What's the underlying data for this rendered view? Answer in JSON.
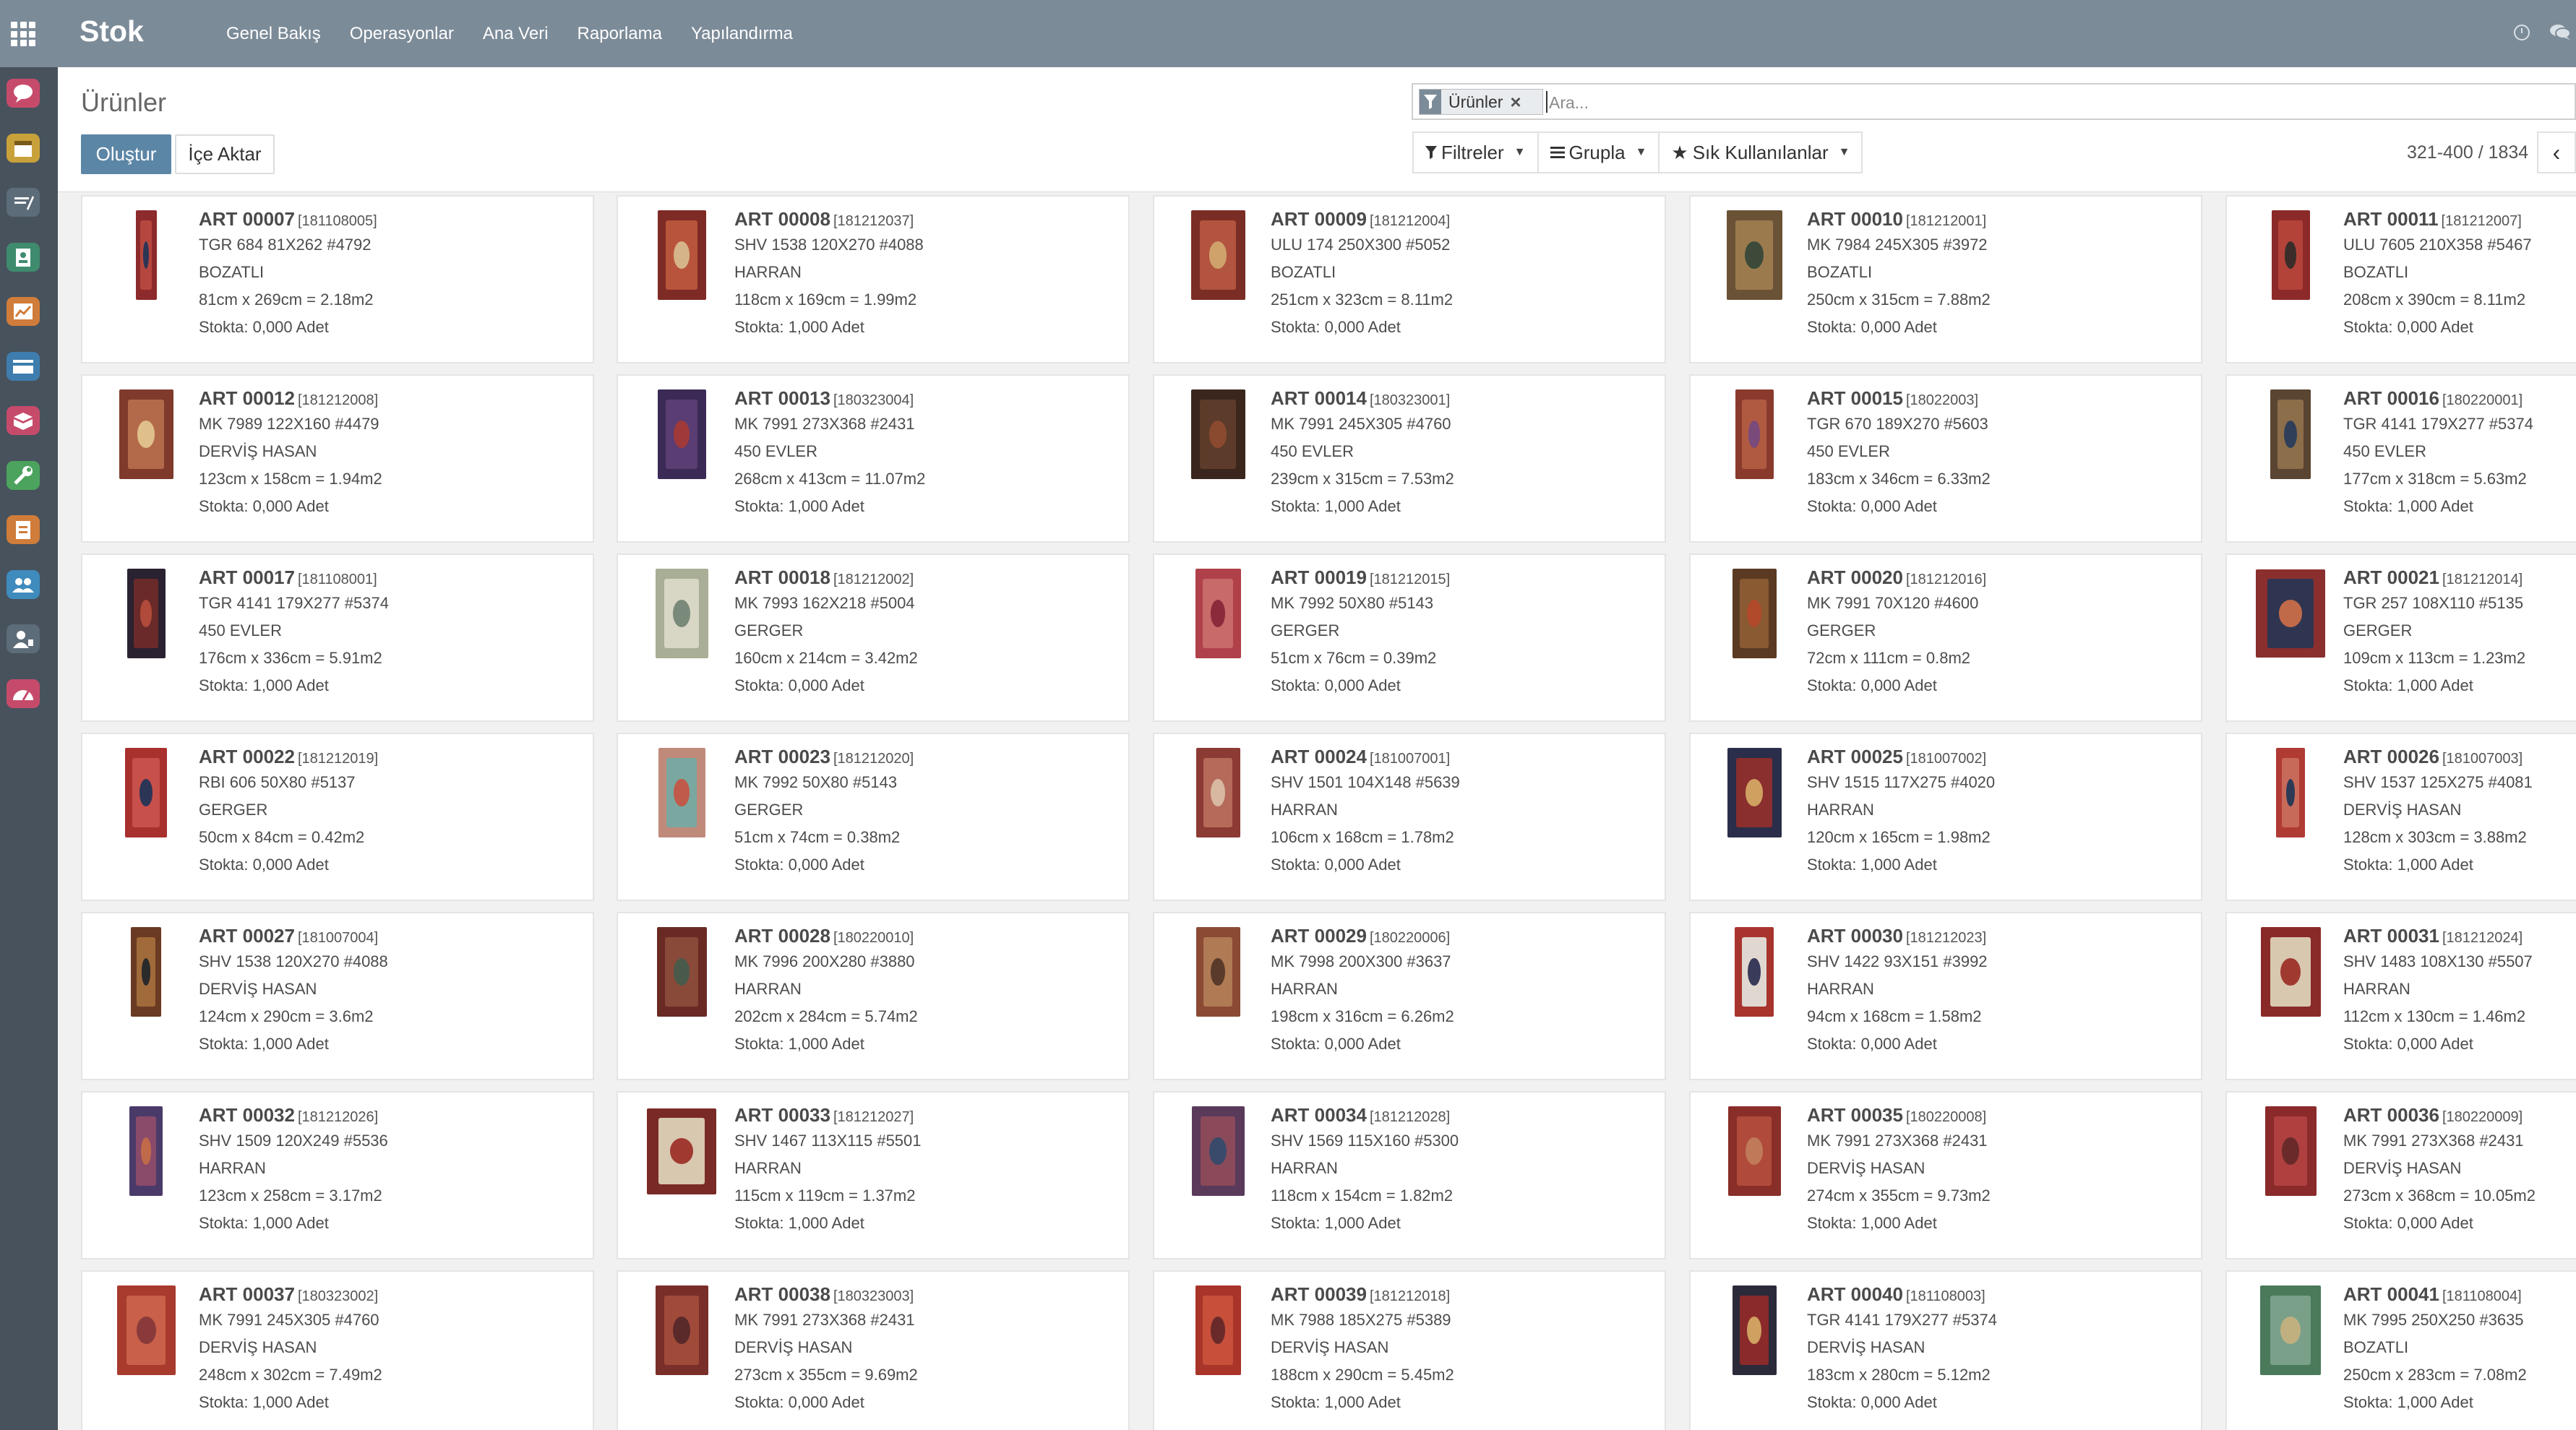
{
  "app": {
    "title": "Stok",
    "menu": [
      "Genel Bakış",
      "Operasyonlar",
      "Ana Veri",
      "Raporlama",
      "Yapılandırma"
    ]
  },
  "sidebar": {
    "items": [
      {
        "icon": "discuss-icon",
        "color": "#c64b6b"
      },
      {
        "icon": "calendar-icon",
        "color": "#c9a13b"
      },
      {
        "icon": "notes-icon",
        "color": "#5d6c79"
      },
      {
        "icon": "contacts-icon",
        "color": "#3f8b6e"
      },
      {
        "icon": "dashboard-icon",
        "color": "#d07c3a"
      },
      {
        "icon": "invoicing-icon",
        "color": "#3f7dae"
      },
      {
        "icon": "inventory-icon",
        "color": "#c64b6b"
      },
      {
        "icon": "settings-icon",
        "color": "#4ca35d"
      },
      {
        "icon": "documents-icon",
        "color": "#d07c3a"
      },
      {
        "icon": "team-icon",
        "color": "#3f8bbd"
      },
      {
        "icon": "employees-icon",
        "color": "#5d6c79"
      },
      {
        "icon": "meter-icon",
        "color": "#c64b6b"
      }
    ]
  },
  "control_panel": {
    "breadcrumb": "Ürünler",
    "create_label": "Oluştur",
    "import_label": "İçe Aktar",
    "search": {
      "facet_label": "Ürünler",
      "facet_remove": "×",
      "placeholder": "Ara..."
    },
    "filters_label": "Filtreler",
    "group_label": "Grupla",
    "favorites_label": "Sık Kullanılanlar",
    "pager": "321-400 / 1834",
    "pager_prev": "‹"
  },
  "products": [
    {
      "name": "ART 00007",
      "code": "[181108005]",
      "model": "TGR 684 81X262 #4792",
      "supplier": "BOZATLI",
      "size": "81cm x 269cm = 2.18m2",
      "stock": "Stokta: 0,000 Adet",
      "rug": {
        "w": 0.3,
        "h": 1.0,
        "base": "#8c2a2c",
        "field": "#b5473e",
        "medal": "#2d3556"
      }
    },
    {
      "name": "ART 00008",
      "code": "[181212037]",
      "model": "SHV 1538 120X270 #4088",
      "supplier": "HARRAN",
      "size": "118cm x 169cm = 1.99m2",
      "stock": "Stokta: 1,000 Adet",
      "rug": {
        "w": 0.7,
        "h": 1.0,
        "base": "#7e2a25",
        "field": "#b8543b",
        "medal": "#d6b48a"
      }
    },
    {
      "name": "ART 00009",
      "code": "[181212004]",
      "model": "ULU 174 250X300 #5052",
      "supplier": "BOZATLI",
      "size": "251cm x 323cm = 8.11m2",
      "stock": "Stokta: 0,000 Adet",
      "rug": {
        "w": 0.78,
        "h": 1.0,
        "base": "#7a2d24",
        "field": "#b2543f",
        "medal": "#cfa26c"
      }
    },
    {
      "name": "ART 00010",
      "code": "[181212001]",
      "model": "MK 7984 245X305 #3972",
      "supplier": "BOZATLI",
      "size": "250cm x 315cm = 7.88m2",
      "stock": "Stokta: 0,000 Adet",
      "rug": {
        "w": 0.8,
        "h": 1.0,
        "base": "#6a5236",
        "field": "#9b7b4e",
        "medal": "#3d4a3a"
      }
    },
    {
      "name": "ART 00011",
      "code": "[181212007]",
      "model": "ULU 7605 210X358 #5467",
      "supplier": "BOZATLI",
      "size": "208cm x 390cm = 8.11m2",
      "stock": "Stokta: 0,000 Adet",
      "rug": {
        "w": 0.55,
        "h": 1.0,
        "base": "#8c2a2a",
        "field": "#b34339",
        "medal": "#3a2d2a"
      }
    },
    {
      "name": "ART 00012",
      "code": "[181212008]",
      "model": "MK 7989 122X160 #4479",
      "supplier": "DERVİŞ HASAN",
      "size": "123cm x 158cm = 1.94m2",
      "stock": "Stokta: 0,000 Adet",
      "rug": {
        "w": 0.78,
        "h": 1.0,
        "base": "#7f3a2b",
        "field": "#b36a4a",
        "medal": "#e0c08a"
      }
    },
    {
      "name": "ART 00013",
      "code": "[180323004]",
      "model": "MK 7991 273X368 #2431",
      "supplier": "450 EVLER",
      "size": "268cm x 413cm = 11.07m2",
      "stock": "Stokta: 1,000 Adet",
      "rug": {
        "w": 0.7,
        "h": 1.0,
        "base": "#3b2a55",
        "field": "#5a3d72",
        "medal": "#a03a3a"
      }
    },
    {
      "name": "ART 00014",
      "code": "[180323001]",
      "model": "MK 7991 245X305 #4760",
      "supplier": "450 EVLER",
      "size": "239cm x 315cm = 7.53m2",
      "stock": "Stokta: 1,000 Adet",
      "rug": {
        "w": 0.78,
        "h": 1.0,
        "base": "#3a261d",
        "field": "#5c3b2a",
        "medal": "#8a4a2f"
      }
    },
    {
      "name": "ART 00015",
      "code": "[18022003]",
      "model": "TGR 670 189X270 #5603",
      "supplier": "450 EVLER",
      "size": "183cm x 346cm = 6.33m2",
      "stock": "Stokta: 0,000 Adet",
      "rug": {
        "w": 0.55,
        "h": 1.0,
        "base": "#8a3a2d",
        "field": "#b05a42",
        "medal": "#7a4a7a"
      }
    },
    {
      "name": "ART 00016",
      "code": "[180220001]",
      "model": "TGR 4141 179X277 #5374",
      "supplier": "450 EVLER",
      "size": "177cm x 318cm = 5.63m2",
      "stock": "Stokta: 1,000 Adet",
      "rug": {
        "w": 0.58,
        "h": 1.0,
        "base": "#5a4432",
        "field": "#8c6e4a",
        "medal": "#2f3f5a"
      }
    },
    {
      "name": "ART 00017",
      "code": "[181108001]",
      "model": "TGR 4141 179X277 #5374",
      "supplier": "450 EVLER",
      "size": "176cm x 336cm = 5.91m2",
      "stock": "Stokta: 1,000 Adet",
      "rug": {
        "w": 0.55,
        "h": 1.0,
        "base": "#2a2230",
        "field": "#6a2a2a",
        "medal": "#b04a3a"
      }
    },
    {
      "name": "ART 00018",
      "code": "[181212002]",
      "model": "MK 7993 162X218 #5004",
      "supplier": "GERGER",
      "size": "160cm x 214cm = 3.42m2",
      "stock": "Stokta: 0,000 Adet",
      "rug": {
        "w": 0.76,
        "h": 1.0,
        "base": "#a9ae96",
        "field": "#d8d6c4",
        "medal": "#7a8a7a"
      }
    },
    {
      "name": "ART 00019",
      "code": "[181212015]",
      "model": "MK 7992 50X80 #5143",
      "supplier": "GERGER",
      "size": "51cm x 76cm = 0.39m2",
      "stock": "Stokta: 0,000 Adet",
      "rug": {
        "w": 0.66,
        "h": 1.0,
        "base": "#b0404a",
        "field": "#c96a6a",
        "medal": "#8a2a3a"
      }
    },
    {
      "name": "ART 00020",
      "code": "[181212016]",
      "model": "MK 7991 70X120 #4600",
      "supplier": "GERGER",
      "size": "72cm x 111cm = 0.8m2",
      "stock": "Stokta: 0,000 Adet",
      "rug": {
        "w": 0.64,
        "h": 1.0,
        "base": "#5a3a22",
        "field": "#8a5a32",
        "medal": "#b04a2a"
      }
    },
    {
      "name": "ART 00021",
      "code": "[181212014]",
      "model": "TGR 257 108X110 #5135",
      "supplier": "GERGER",
      "size": "109cm x 113cm = 1.23m2",
      "stock": "Stokta: 1,000 Adet",
      "rug": {
        "w": 1.0,
        "h": 0.98,
        "base": "#8a2e2e",
        "field": "#2f3550",
        "medal": "#c06a4a"
      }
    },
    {
      "name": "ART 00022",
      "code": "[181212019]",
      "model": "RBI 606 50X80 #5137",
      "supplier": "GERGER",
      "size": "50cm x 84cm = 0.42m2",
      "stock": "Stokta: 0,000 Adet",
      "rug": {
        "w": 0.6,
        "h": 1.0,
        "base": "#a8302d",
        "field": "#c8504a",
        "medal": "#2d3556"
      }
    },
    {
      "name": "ART 00023",
      "code": "[181212020]",
      "model": "MK 7992 50X80 #5143",
      "supplier": "GERGER",
      "size": "51cm x 74cm = 0.38m2",
      "stock": "Stokta: 0,000 Adet",
      "rug": {
        "w": 0.68,
        "h": 1.0,
        "base": "#c08a7a",
        "field": "#7aa8a0",
        "medal": "#c05a4a"
      }
    },
    {
      "name": "ART 00024",
      "code": "[181007001]",
      "model": "SHV 1501 104X148 #5639",
      "supplier": "HARRAN",
      "size": "106cm x 168cm = 1.78m2",
      "stock": "Stokta: 0,000 Adet",
      "rug": {
        "w": 0.64,
        "h": 1.0,
        "base": "#8c3a34",
        "field": "#b56a5a",
        "medal": "#d8b8a0"
      }
    },
    {
      "name": "ART 00025",
      "code": "[181007002]",
      "model": "SHV 1515 117X275 #4020",
      "supplier": "HARRAN",
      "size": "120cm x 165cm = 1.98m2",
      "stock": "Stokta: 1,000 Adet",
      "rug": {
        "w": 0.78,
        "h": 1.0,
        "base": "#2a2e4a",
        "field": "#8a2e2e",
        "medal": "#d0a060"
      }
    },
    {
      "name": "ART 00026",
      "code": "[181007003]",
      "model": "SHV 1537 125X275 #4081",
      "supplier": "DERVİŞ HASAN",
      "size": "128cm x 303cm = 3.88m2",
      "stock": "Stokta: 1,000 Adet",
      "rug": {
        "w": 0.42,
        "h": 1.0,
        "base": "#b03a34",
        "field": "#c86a5a",
        "medal": "#2d3a56"
      }
    },
    {
      "name": "ART 00027",
      "code": "[181007004]",
      "model": "SHV 1538 120X270 #4088",
      "supplier": "DERVİŞ HASAN",
      "size": "124cm x 290cm = 3.6m2",
      "stock": "Stokta: 1,000 Adet",
      "rug": {
        "w": 0.44,
        "h": 1.0,
        "base": "#6a3a22",
        "field": "#a06a3a",
        "medal": "#2a2a2a"
      }
    },
    {
      "name": "ART 00028",
      "code": "[180220010]",
      "model": "MK 7996 200X280 #3880",
      "supplier": "HARRAN",
      "size": "202cm x 284cm = 5.74m2",
      "stock": "Stokta: 1,000 Adet",
      "rug": {
        "w": 0.72,
        "h": 1.0,
        "base": "#6a2a24",
        "field": "#8a4a3a",
        "medal": "#4a5a4a"
      }
    },
    {
      "name": "ART 00029",
      "code": "[180220006]",
      "model": "MK 7998 200X300 #3637",
      "supplier": "HARRAN",
      "size": "198cm x 316cm = 6.26m2",
      "stock": "Stokta: 0,000 Adet",
      "rug": {
        "w": 0.64,
        "h": 1.0,
        "base": "#8a4a34",
        "field": "#b07a54",
        "medal": "#5a3a2a"
      }
    },
    {
      "name": "ART 00030",
      "code": "[181212023]",
      "model": "SHV 1422 93X151 #3992",
      "supplier": "HARRAN",
      "size": "94cm x 168cm = 1.58m2",
      "stock": "Stokta: 0,000 Adet",
      "rug": {
        "w": 0.56,
        "h": 1.0,
        "base": "#a8342e",
        "field": "#e0d8d0",
        "medal": "#3a3a5a"
      }
    },
    {
      "name": "ART 00031",
      "code": "[181212024]",
      "model": "SHV 1483 108X130 #5507",
      "supplier": "HARRAN",
      "size": "112cm x 130cm = 1.46m2",
      "stock": "Stokta: 0,000 Adet",
      "rug": {
        "w": 0.86,
        "h": 1.0,
        "base": "#8a2a28",
        "field": "#d8c8b0",
        "medal": "#a03a30"
      }
    },
    {
      "name": "ART 00032",
      "code": "[181212026]",
      "model": "SHV 1509 120X249 #5536",
      "supplier": "HARRAN",
      "size": "123cm x 258cm = 3.17m2",
      "stock": "Stokta: 1,000 Adet",
      "rug": {
        "w": 0.48,
        "h": 1.0,
        "base": "#4a3a6a",
        "field": "#8a4a6a",
        "medal": "#c06a4a"
      }
    },
    {
      "name": "ART 00033",
      "code": "[181212027]",
      "model": "SHV 1467 113X115 #5501",
      "supplier": "HARRAN",
      "size": "115cm x 119cm = 1.37m2",
      "stock": "Stokta: 1,000 Adet",
      "rug": {
        "w": 1.0,
        "h": 0.96,
        "base": "#7a2a26",
        "field": "#d8c8b0",
        "medal": "#a03a30"
      }
    },
    {
      "name": "ART 00034",
      "code": "[181212028]",
      "model": "SHV 1569 115X160 #5300",
      "supplier": "HARRAN",
      "size": "118cm x 154cm = 1.82m2",
      "stock": "Stokta: 1,000 Adet",
      "rug": {
        "w": 0.76,
        "h": 1.0,
        "base": "#5a3a5a",
        "field": "#8a4a5a",
        "medal": "#3a4a6a"
      }
    },
    {
      "name": "ART 00035",
      "code": "[180220008]",
      "model": "MK 7991 273X368 #2431",
      "supplier": "DERVİŞ HASAN",
      "size": "274cm x 355cm = 9.73m2",
      "stock": "Stokta: 1,000 Adet",
      "rug": {
        "w": 0.76,
        "h": 1.0,
        "base": "#8a2e2a",
        "field": "#b04a3a",
        "medal": "#c07a5a"
      }
    },
    {
      "name": "ART 00036",
      "code": "[180220009]",
      "model": "MK 7991 273X368 #2431",
      "supplier": "DERVİŞ HASAN",
      "size": "273cm x 368cm = 10.05m2",
      "stock": "Stokta: 0,000 Adet",
      "rug": {
        "w": 0.74,
        "h": 1.0,
        "base": "#8a2a2a",
        "field": "#b04040",
        "medal": "#6a2a2a"
      }
    },
    {
      "name": "ART 00037",
      "code": "[180323002]",
      "model": "MK 7991 245X305 #4760",
      "supplier": "DERVİŞ HASAN",
      "size": "248cm x 302cm = 7.49m2",
      "stock": "Stokta: 1,000 Adet",
      "rug": {
        "w": 0.84,
        "h": 1.0,
        "base": "#a83a2e",
        "field": "#c8604a",
        "medal": "#8a3a3a"
      }
    },
    {
      "name": "ART 00038",
      "code": "[180323003]",
      "model": "MK 7991 273X368 #2431",
      "supplier": "DERVİŞ HASAN",
      "size": "273cm x 355cm = 9.69m2",
      "stock": "Stokta: 0,000 Adet",
      "rug": {
        "w": 0.76,
        "h": 1.0,
        "base": "#7a2e2a",
        "field": "#a04a3a",
        "medal": "#5a2a2a"
      }
    },
    {
      "name": "ART 00039",
      "code": "[181212018]",
      "model": "MK 7988 185X275 #5389",
      "supplier": "DERVİŞ HASAN",
      "size": "188cm x 290cm = 5.45m2",
      "stock": "Stokta: 1,000 Adet",
      "rug": {
        "w": 0.66,
        "h": 1.0,
        "base": "#a8342a",
        "field": "#c8503a",
        "medal": "#6a2a2a"
      }
    },
    {
      "name": "ART 00040",
      "code": "[181108003]",
      "model": "TGR 4141 179X277 #5374",
      "supplier": "DERVİŞ HASAN",
      "size": "183cm x 280cm = 5.12m2",
      "stock": "Stokta: 0,000 Adet",
      "rug": {
        "w": 0.64,
        "h": 1.0,
        "base": "#2a2a3a",
        "field": "#8a2a2a",
        "medal": "#d0a060"
      }
    },
    {
      "name": "ART 00041",
      "code": "[181108004]",
      "model": "MK 7995 250X250 #3635",
      "supplier": "BOZATLI",
      "size": "250cm x 283cm = 7.08m2",
      "stock": "Stokta: 1,000 Adet",
      "rug": {
        "w": 0.88,
        "h": 1.0,
        "base": "#4a7a5a",
        "field": "#7aa08a",
        "medal": "#c0b080"
      }
    }
  ]
}
